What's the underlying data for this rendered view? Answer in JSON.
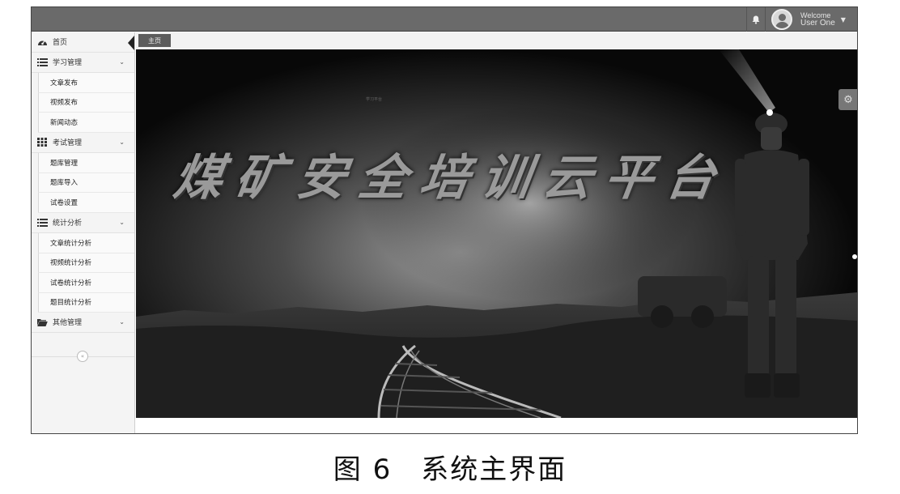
{
  "topbar": {
    "user_greeting": "Welcome",
    "user_name": "User One"
  },
  "sidebar": {
    "home_label": "首页",
    "groups": [
      {
        "label": "学习管理",
        "icon": "list-icon",
        "items": [
          "文章发布",
          "视频发布",
          "新闻动态"
        ]
      },
      {
        "label": "考试管理",
        "icon": "grid-icon",
        "items": [
          "题库管理",
          "题库导入",
          "试卷设置"
        ]
      },
      {
        "label": "统计分析",
        "icon": "list-icon",
        "items": [
          "文章统计分析",
          "视频统计分析",
          "试卷统计分析",
          "题目统计分析"
        ]
      },
      {
        "label": "其他管理",
        "icon": "folder-icon",
        "items": []
      }
    ]
  },
  "tabs": {
    "home": "主页"
  },
  "banner": {
    "title": "煤矿安全培训云平台",
    "small_text": "学习平台"
  },
  "caption": "图 6　系统主界面",
  "colors": {
    "topbar": "#6a6a6a",
    "sidebar_bg": "#f4f4f4",
    "banner_bg": "#060606"
  }
}
